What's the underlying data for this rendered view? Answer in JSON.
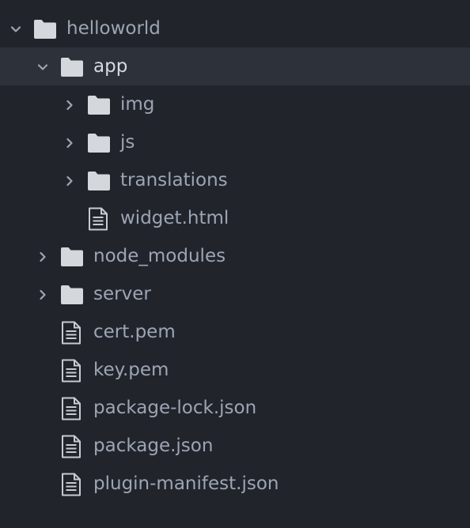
{
  "colors": {
    "background": "#21252b",
    "selected_row": "#2c313a",
    "label_text": "#9da5b4",
    "selected_label_text": "#d7dae0",
    "folder_icon": "#d4d7dc",
    "file_icon": "#c8ccd2"
  },
  "tree": {
    "items": [
      {
        "name": "helloworld",
        "type": "folder",
        "expanded": true,
        "selected": false,
        "depth": 0
      },
      {
        "name": "app",
        "type": "folder",
        "expanded": true,
        "selected": true,
        "depth": 1
      },
      {
        "name": "img",
        "type": "folder",
        "expanded": false,
        "selected": false,
        "depth": 2
      },
      {
        "name": "js",
        "type": "folder",
        "expanded": false,
        "selected": false,
        "depth": 2
      },
      {
        "name": "translations",
        "type": "folder",
        "expanded": false,
        "selected": false,
        "depth": 2
      },
      {
        "name": "widget.html",
        "type": "file",
        "selected": false,
        "depth": 2
      },
      {
        "name": "node_modules",
        "type": "folder",
        "expanded": false,
        "selected": false,
        "depth": 1
      },
      {
        "name": "server",
        "type": "folder",
        "expanded": false,
        "selected": false,
        "depth": 1
      },
      {
        "name": "cert.pem",
        "type": "file",
        "selected": false,
        "depth": 1
      },
      {
        "name": "key.pem",
        "type": "file",
        "selected": false,
        "depth": 1
      },
      {
        "name": "package-lock.json",
        "type": "file",
        "selected": false,
        "depth": 1
      },
      {
        "name": "package.json",
        "type": "file",
        "selected": false,
        "depth": 1
      },
      {
        "name": "plugin-manifest.json",
        "type": "file",
        "selected": false,
        "depth": 1
      }
    ]
  }
}
